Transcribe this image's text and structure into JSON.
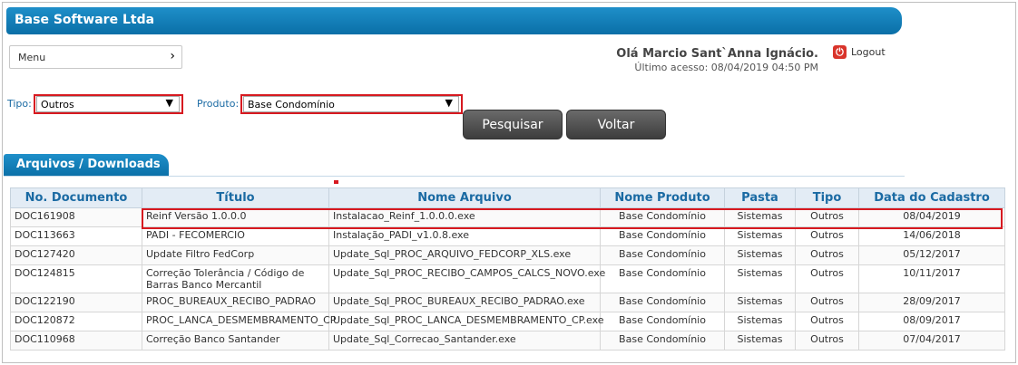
{
  "app": {
    "title": "Base Software Ltda"
  },
  "menu": {
    "label": "Menu",
    "chevron": "›"
  },
  "user": {
    "greeting": "Olá Marcio Sant`Anna Ignácio.",
    "last_access": "Último acesso: 08/04/2019  04:50 PM",
    "logout_label": "Logout"
  },
  "filters": {
    "tipo_label": "Tipo:",
    "tipo_value": "Outros",
    "produto_label": "Produto:",
    "produto_value": "Base Condomínio"
  },
  "actions": {
    "search_label": "Pesquisar",
    "back_label": "Voltar"
  },
  "section": {
    "title": "Arquivos / Downloads"
  },
  "table": {
    "columns": [
      "No. Documento",
      "Título",
      "Nome Arquivo",
      "Nome Produto",
      "Pasta",
      "Tipo",
      "Data do Cadastro"
    ],
    "rows": [
      [
        "DOC161908",
        "Reinf Versão 1.0.0.0",
        "Instalacao_Reinf_1.0.0.0.exe",
        "Base Condomínio",
        "Sistemas",
        "Outros",
        "08/04/2019"
      ],
      [
        "DOC113663",
        "PADI - FECOMERCIO",
        "Instalação_PADI_v1.0.8.exe",
        "Base Condomínio",
        "Sistemas",
        "Outros",
        "14/06/2018"
      ],
      [
        "DOC127420",
        "Update Filtro FedCorp",
        "Update_Sql_PROC_ARQUIVO_FEDCORP_XLS.exe",
        "Base Condomínio",
        "Sistemas",
        "Outros",
        "05/12/2017"
      ],
      [
        "DOC124815",
        "Correção Tolerância / Código de Barras Banco Mercantil",
        "Update_Sql_PROC_RECIBO_CAMPOS_CALCS_NOVO.exe",
        "Base Condomínio",
        "Sistemas",
        "Outros",
        "10/11/2017"
      ],
      [
        "DOC122190",
        "PROC_BUREAUX_RECIBO_PADRAO",
        "Update_Sql_PROC_BUREAUX_RECIBO_PADRAO.exe",
        "Base Condomínio",
        "Sistemas",
        "Outros",
        "28/09/2017"
      ],
      [
        "DOC120872",
        "PROC_LANCA_DESMEMBRAMENTO_CP",
        "Update_Sql_PROC_LANCA_DESMEMBRAMENTO_CP.exe",
        "Base Condomínio",
        "Sistemas",
        "Outros",
        "08/09/2017"
      ],
      [
        "DOC110968",
        "Correção Banco Santander",
        "Update_Sql_Correcao_Santander.exe",
        "Base Condomínio",
        "Sistemas",
        "Outros",
        "07/04/2017"
      ]
    ]
  },
  "colors": {
    "header_blue": "#0a6fa7",
    "highlight_red": "#d71920",
    "button_dark": "#3d3d3d"
  }
}
